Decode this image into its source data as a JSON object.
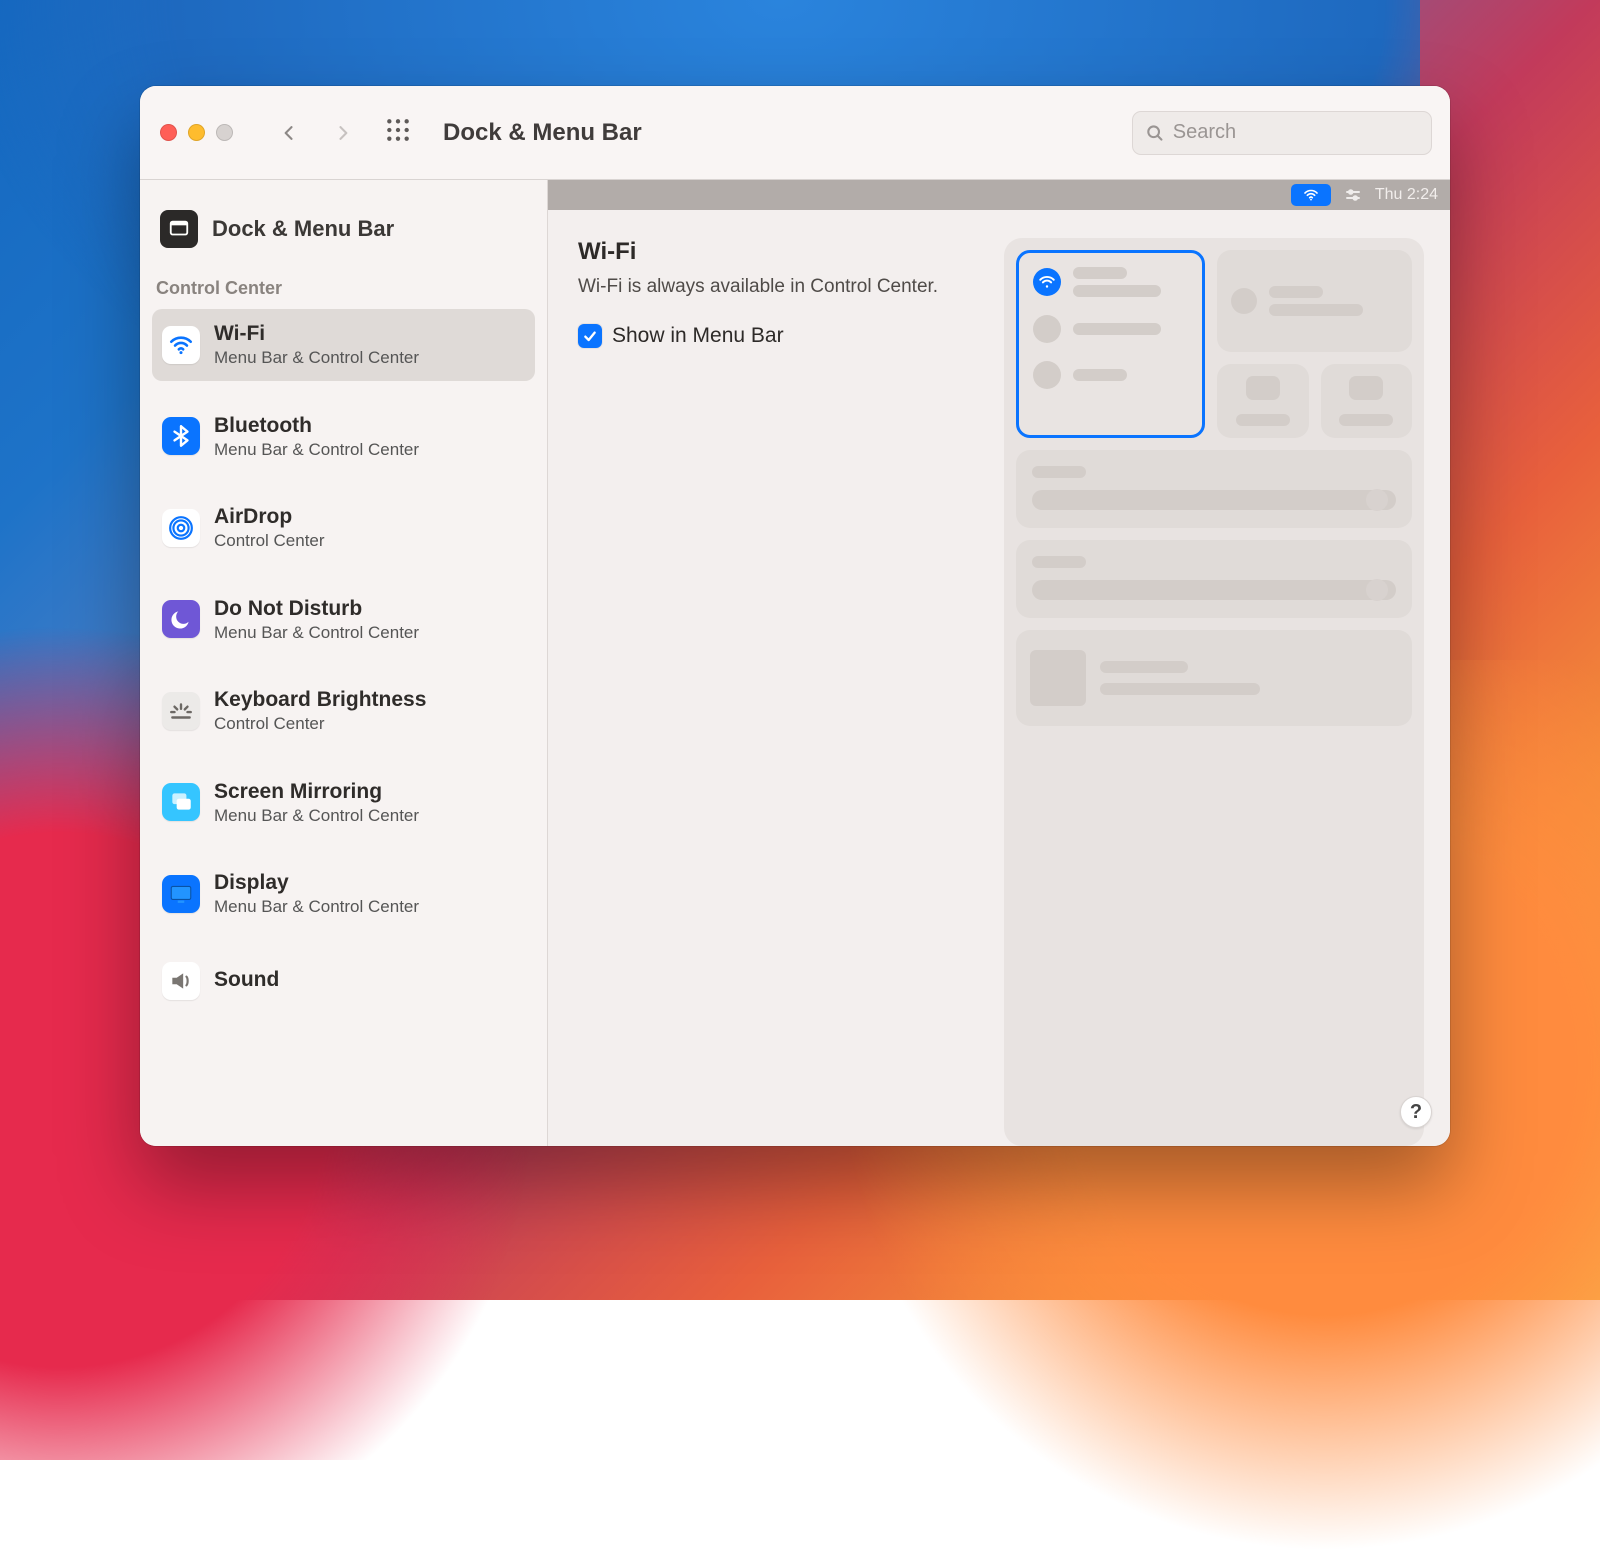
{
  "titlebar": {
    "title": "Dock & Menu Bar",
    "search_placeholder": "Search"
  },
  "menubar": {
    "time": "Thu 2:24"
  },
  "sidebar": {
    "header_label": "Dock & Menu Bar",
    "section_label": "Control Center",
    "items": [
      {
        "label": "Wi-Fi",
        "sub": "Menu Bar & Control Center",
        "icon": "wifi",
        "selected": true
      },
      {
        "label": "Bluetooth",
        "sub": "Menu Bar & Control Center",
        "icon": "bluetooth",
        "selected": false
      },
      {
        "label": "AirDrop",
        "sub": "Control Center",
        "icon": "airdrop",
        "selected": false
      },
      {
        "label": "Do Not Disturb",
        "sub": "Menu Bar & Control Center",
        "icon": "moon",
        "selected": false
      },
      {
        "label": "Keyboard Brightness",
        "sub": "Control Center",
        "icon": "kbbright",
        "selected": false
      },
      {
        "label": "Screen Mirroring",
        "sub": "Menu Bar & Control Center",
        "icon": "mirror",
        "selected": false
      },
      {
        "label": "Display",
        "sub": "Menu Bar & Control Center",
        "icon": "display",
        "selected": false
      },
      {
        "label": "Sound",
        "sub": "",
        "icon": "sound",
        "selected": false
      }
    ]
  },
  "detail": {
    "title": "Wi-Fi",
    "description": "Wi-Fi is always available in Control Center.",
    "checkbox_label": "Show in Menu Bar",
    "checkbox_checked": true
  },
  "help_label": "?"
}
